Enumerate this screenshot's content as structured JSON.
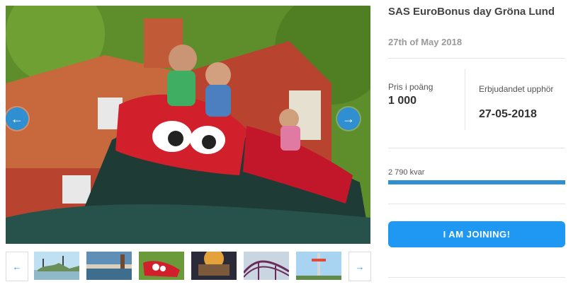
{
  "gallery": {
    "main_image_alt": "roller-coaster-photo",
    "prev_icon": "arrow-left-icon",
    "next_icon": "arrow-right-icon",
    "prev_glyph": "←",
    "next_glyph": "→",
    "thumbnails": [
      "amusement-park-skyline",
      "waterfront-boardwalk",
      "roller-coaster-car",
      "carousel-ride",
      "coaster-track",
      "drop-tower"
    ]
  },
  "offer": {
    "title": "SAS EuroBonus day Gröna Lund",
    "date": "27th of May 2018",
    "price_label": "Pris i poäng",
    "price_value": "1 000",
    "expires_label": "Erbjudandet upphör",
    "expires_value": "27-05-2018",
    "remaining_text": "2 790 kvar",
    "progress_fraction": 1.0,
    "join_label": "I AM JOINING!"
  },
  "colors": {
    "accent": "#2f8fd0",
    "join_button": "#1f98f3"
  }
}
